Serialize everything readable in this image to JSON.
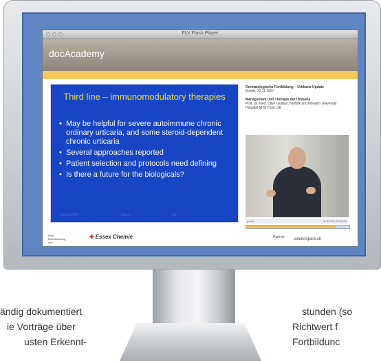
{
  "window": {
    "title": "FLV Flash Player"
  },
  "header": {
    "brand": "docAcademy"
  },
  "slide": {
    "title": "Third line – immunomodulatory therapies",
    "bullets": [
      "May be helpful for severe autoimmune chronic ordinary urticaria, and some steroid-dependent chronic urticaria",
      "Several approaches reported",
      "Patient selection and protocols need defining",
      "Is there a future for the biologicals?"
    ],
    "footer": [
      "Zürich 2007",
      "Zürich",
      "18"
    ]
  },
  "info": {
    "course_title": "Dermatologische Fortbildung – Urtikaria Update",
    "course_place_date": "Zürich, 22.11.2007",
    "talk_title": "Management und Therapie der Urtikaria",
    "speaker": "Prof. Dr. med. Clive Grattan, Norfolk and Norwich University Hospital NHS Trust, UK"
  },
  "video": {
    "pause_label": "pause",
    "time": "00:40:22 | 00:46:22",
    "progress_fraction": 0.87
  },
  "footer": {
    "organizer_label": "Eine Dienstleistung von:",
    "sponsor": "Essex Chemie",
    "partner_label": "Partner:",
    "partner": "solutionpark.ch"
  },
  "page_text": {
    "left_line1": "ändig dokumentiert",
    "left_line2": "ie Vorträge über",
    "left_line3": "usten Erkennt-",
    "right_line1": "stunden (so",
    "right_line2": "Richtwert f",
    "right_line3": "Fortbildunc"
  },
  "colors": {
    "screen": "#5f86c2",
    "slide_bg": "#1845c4",
    "slide_title": "#f4e13b",
    "accent_bar": "#f2c85f"
  }
}
